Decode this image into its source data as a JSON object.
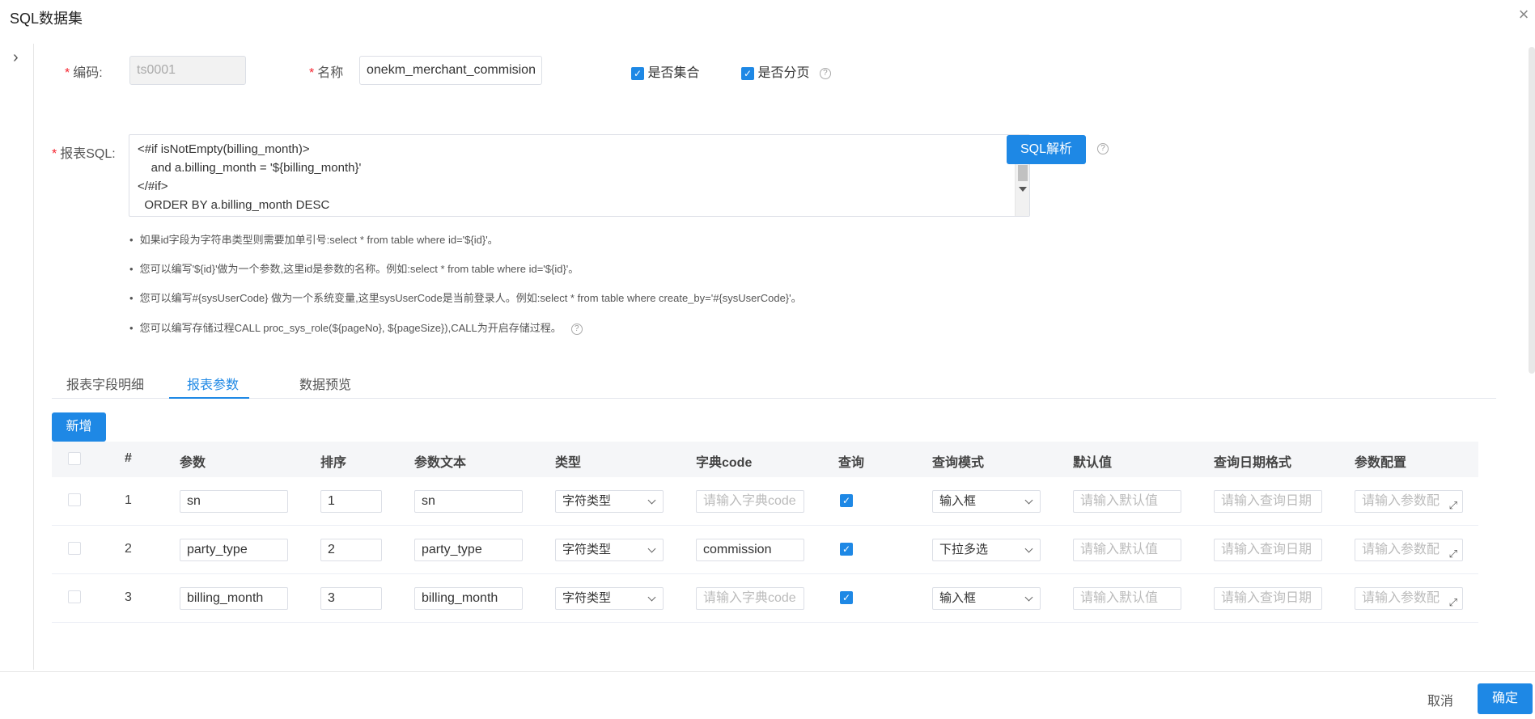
{
  "dialog": {
    "title": "SQL数据集",
    "close_icon": "×"
  },
  "nav": {
    "expand_icon": "›"
  },
  "form": {
    "code": {
      "label": "编码:",
      "value": "ts0001"
    },
    "name": {
      "label": "名称",
      "value": "onekm_merchant_commision"
    },
    "is_collection": {
      "label": "是否集合",
      "checked": true
    },
    "is_paged": {
      "label": "是否分页",
      "checked": true
    },
    "sql": {
      "label": "报表SQL:",
      "lines": [
        "<#if isNotEmpty(billing_month)>",
        "    and a.billing_month = '${billing_month}'",
        "</#if>",
        "  ORDER BY a.billing_month DESC"
      ]
    },
    "parse_button": "SQL解析",
    "tips": [
      "如果id字段为字符串类型则需要加单引号:select * from table where id='${id}'。",
      "您可以编写'${id}'做为一个参数,这里id是参数的名称。例如:select * from table where id='${id}'。",
      "您可以编写#{sysUserCode} 做为一个系统变量,这里sysUserCode是当前登录人。例如:select * from table where create_by='#{sysUserCode}'。",
      "您可以编写存储过程CALL proc_sys_role(${pageNo}, ${pageSize}),CALL为开启存储过程。"
    ]
  },
  "tabs": [
    {
      "label": "报表字段明细",
      "active": false
    },
    {
      "label": "报表参数",
      "active": true
    },
    {
      "label": "数据预览",
      "active": false
    }
  ],
  "add_button": "新增",
  "table": {
    "columns": [
      "#",
      "参数",
      "排序",
      "参数文本",
      "类型",
      "字典code",
      "查询",
      "查询模式",
      "默认值",
      "查询日期格式",
      "参数配置"
    ],
    "placeholders": {
      "dict_code": "请输入字典code",
      "default": "请输入默认值",
      "date_format": "请输入查询日期",
      "config": "请输入参数配"
    },
    "rows": [
      {
        "index": "1",
        "param": "sn",
        "order": "1",
        "text": "sn",
        "type": "字符类型",
        "dict_code": "",
        "query": true,
        "mode": "输入框"
      },
      {
        "index": "2",
        "param": "party_type",
        "order": "2",
        "text": "party_type",
        "type": "字符类型",
        "dict_code": "commission",
        "query": true,
        "mode": "下拉多选"
      },
      {
        "index": "3",
        "param": "billing_month",
        "order": "3",
        "text": "billing_month",
        "type": "字符类型",
        "dict_code": "",
        "query": true,
        "mode": "输入框"
      }
    ]
  },
  "footer": {
    "cancel": "取消",
    "confirm": "确定"
  },
  "colors": {
    "primary": "#1e88e5",
    "required": "#f5222d"
  }
}
